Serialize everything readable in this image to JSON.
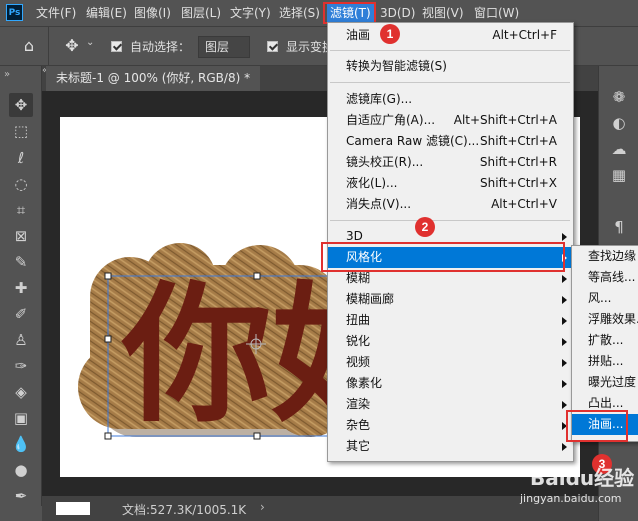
{
  "app": {
    "logo_text": "Ps"
  },
  "menubar": {
    "items": [
      {
        "label": "文件(F)"
      },
      {
        "label": "编辑(E)"
      },
      {
        "label": "图像(I)"
      },
      {
        "label": "图层(L)"
      },
      {
        "label": "文字(Y)"
      },
      {
        "label": "选择(S)"
      },
      {
        "label": "滤镜(T)"
      },
      {
        "label": "3D(D)"
      },
      {
        "label": "视图(V)"
      },
      {
        "label": "窗口(W)"
      }
    ]
  },
  "options_bar": {
    "auto_select_label": "自动选择：",
    "auto_select_checked": true,
    "auto_select_target": "图层",
    "show_transform_label": "显示变换",
    "show_transform_checked": true
  },
  "document": {
    "tab_title": "未标题-1 @ 100% (你好, RGB/8) *",
    "canvas_text": "你好",
    "status_text": "文档:527.3K/1005.1K"
  },
  "filter_menu": {
    "items": [
      {
        "label": "油画",
        "shortcut": "Alt+Ctrl+F"
      },
      {
        "label": "转换为智能滤镜(S)",
        "shortcut": ""
      },
      {
        "label": "滤镜库(G)...",
        "shortcut": ""
      },
      {
        "label": "自适应广角(A)...",
        "shortcut": "Alt+Shift+Ctrl+A"
      },
      {
        "label": "Camera Raw 滤镜(C)...",
        "shortcut": "Shift+Ctrl+A"
      },
      {
        "label": "镜头校正(R)...",
        "shortcut": "Shift+Ctrl+R"
      },
      {
        "label": "液化(L)...",
        "shortcut": "Shift+Ctrl+X"
      },
      {
        "label": "消失点(V)...",
        "shortcut": "Alt+Ctrl+V"
      },
      {
        "label": "3D",
        "shortcut": ""
      },
      {
        "label": "风格化",
        "shortcut": ""
      },
      {
        "label": "模糊",
        "shortcut": ""
      },
      {
        "label": "模糊画廊",
        "shortcut": ""
      },
      {
        "label": "扭曲",
        "shortcut": ""
      },
      {
        "label": "锐化",
        "shortcut": ""
      },
      {
        "label": "视频",
        "shortcut": ""
      },
      {
        "label": "像素化",
        "shortcut": ""
      },
      {
        "label": "渲染",
        "shortcut": ""
      },
      {
        "label": "杂色",
        "shortcut": ""
      },
      {
        "label": "其它",
        "shortcut": ""
      }
    ]
  },
  "stylize_submenu": {
    "items": [
      {
        "label": "查找边缘"
      },
      {
        "label": "等高线..."
      },
      {
        "label": "风..."
      },
      {
        "label": "浮雕效果..."
      },
      {
        "label": "扩散..."
      },
      {
        "label": "拼贴..."
      },
      {
        "label": "曝光过度"
      },
      {
        "label": "凸出..."
      },
      {
        "label": "油画..."
      }
    ]
  },
  "annotations": {
    "step1": "1",
    "step2": "2",
    "step3": "3"
  },
  "watermark": {
    "brand": "Baidu经验",
    "url": "jingyan.baidu.com"
  },
  "colors": {
    "accent": "#2f7fd8",
    "highlight": "#0078d7",
    "annotation_red": "#e0312f",
    "text_fill": "#6b1e12"
  }
}
